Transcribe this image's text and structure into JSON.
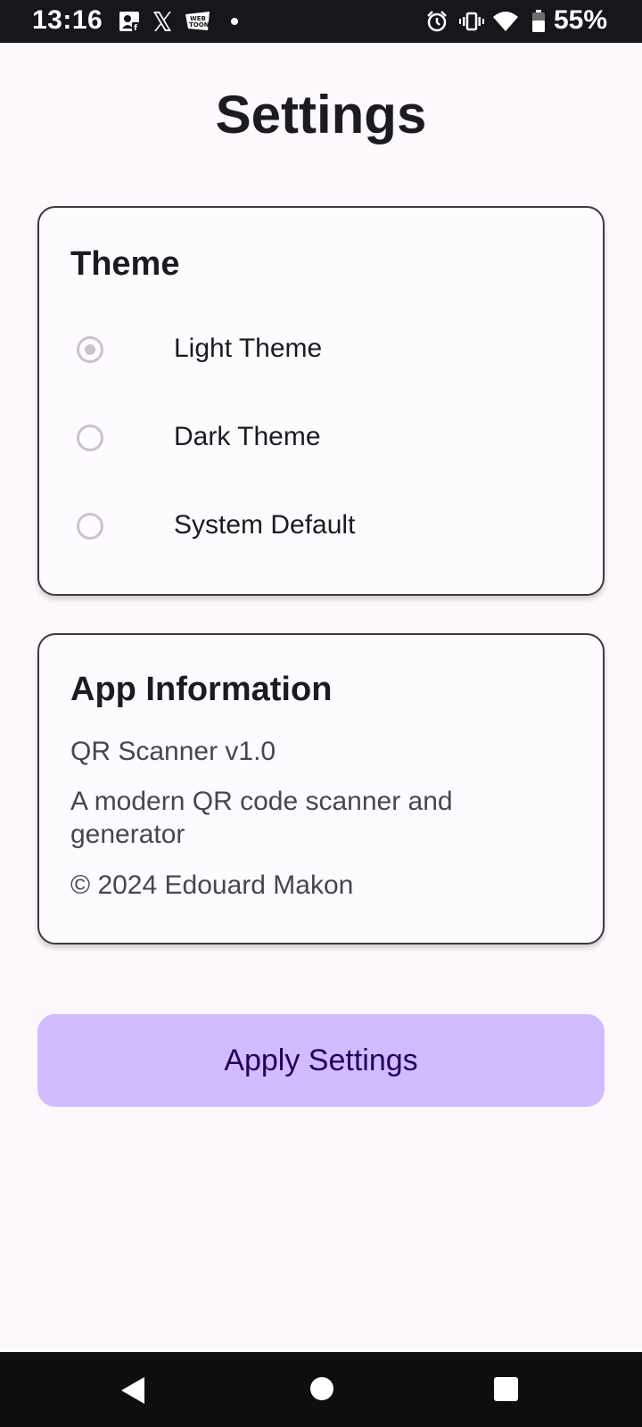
{
  "status_bar": {
    "time": "13:16",
    "battery": "55%",
    "left_icons": [
      "contact-card-icon",
      "x-logo-icon",
      "webtoon-icon",
      "notification-dot"
    ],
    "right_icons": [
      "alarm-icon",
      "vibrate-icon",
      "wifi-icon",
      "battery-icon"
    ]
  },
  "page": {
    "title": "Settings"
  },
  "theme_card": {
    "title": "Theme",
    "options": [
      {
        "label": "Light Theme",
        "selected": true
      },
      {
        "label": "Dark Theme",
        "selected": false
      },
      {
        "label": "System Default",
        "selected": false
      }
    ]
  },
  "info_card": {
    "title": "App Information",
    "version": "QR Scanner v1.0",
    "description": "A modern QR code scanner and generator",
    "copyright": "© 2024 Edouard Makon"
  },
  "actions": {
    "apply_label": "Apply Settings"
  },
  "colors": {
    "background": "#fdf8fc",
    "button": "#d0bcff",
    "button_text": "#21005d",
    "radio": "#c9c3cf"
  }
}
